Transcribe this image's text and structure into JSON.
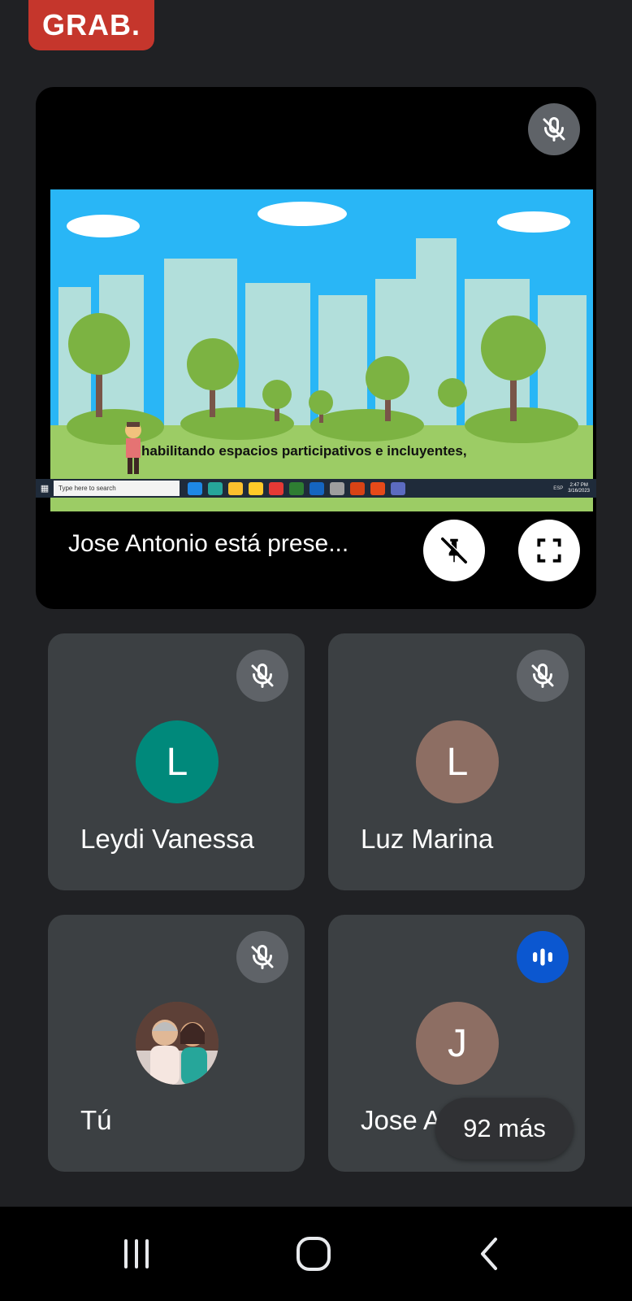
{
  "recording_badge": "GRAB.",
  "presentation": {
    "caption": "habilitando espacios participativos e incluyentes,",
    "label": "Jose Antonio está prese...",
    "taskbar": {
      "search_placeholder": "Type here to search",
      "language": "ESP",
      "time": "2:47 PM",
      "date": "3/16/2023"
    }
  },
  "participants": [
    {
      "initial": "L",
      "name": "Leydi Vanessa",
      "avatar_color": "#00897b",
      "muted": true
    },
    {
      "initial": "L",
      "name": "Luz Marina",
      "avatar_color": "#8d6e63",
      "muted": true
    },
    {
      "initial": "",
      "name": "Tú",
      "avatar_color": "#b08968",
      "muted": true
    },
    {
      "initial": "J",
      "name": "Jose Antonio",
      "avatar_color": "#8d6e63",
      "speaking": true
    }
  ],
  "more_participants": "92 más",
  "icons": {
    "mic_off": "mic-off-icon",
    "unpin": "unpin-icon",
    "fullscreen": "fullscreen-icon",
    "speaking": "audio-level-icon",
    "nav_recents": "recents-icon",
    "nav_home": "home-icon",
    "nav_back": "back-icon"
  }
}
